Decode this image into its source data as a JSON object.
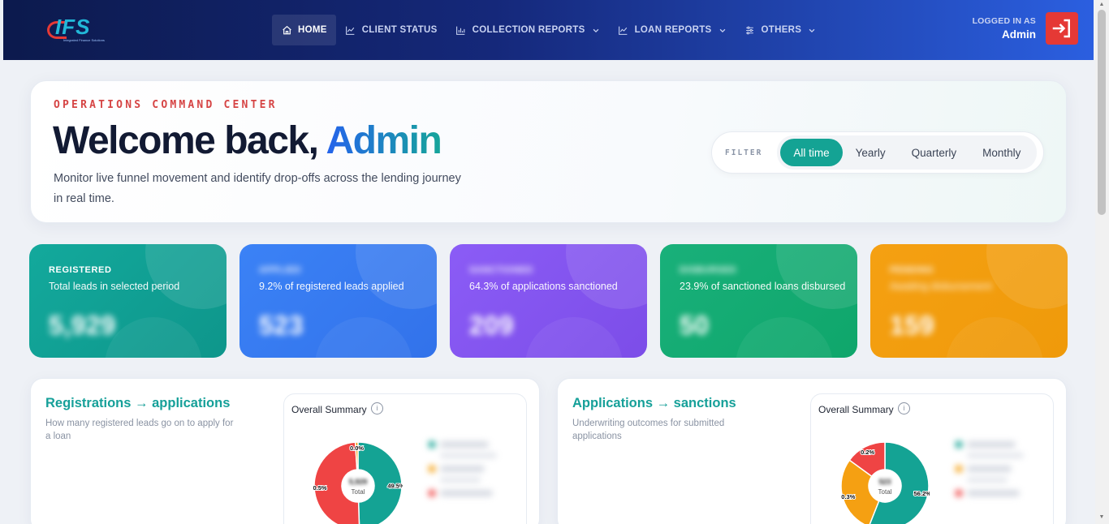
{
  "nav": {
    "logo_text": "IFS",
    "logo_tagline": "Integrated Finance Solutions",
    "items": [
      {
        "label": "HOME",
        "icon": "home-icon",
        "active": true
      },
      {
        "label": "CLIENT STATUS",
        "icon": "line-chart-icon"
      },
      {
        "label": "COLLECTION REPORTS",
        "icon": "bar-chart-icon",
        "dropdown": true
      },
      {
        "label": "LOAN REPORTS",
        "icon": "line-chart-icon",
        "dropdown": true
      },
      {
        "label": "OTHERS",
        "icon": "sliders-icon",
        "dropdown": true
      }
    ],
    "logged_in_label": "LOGGED IN AS",
    "user": "Admin"
  },
  "hero": {
    "eyebrow": "OPERATIONS COMMAND CENTER",
    "welcome_prefix": "Welcome back, ",
    "welcome_name": "Admin",
    "description": "Monitor live funnel movement and identify drop-offs across the lending journey in real time."
  },
  "filter": {
    "label": "FILTER",
    "options": [
      "All time",
      "Yearly",
      "Quarterly",
      "Monthly"
    ],
    "selected": "All time"
  },
  "stats": [
    {
      "title": "REGISTERED",
      "desc": "Total leads in selected period",
      "value": "5,929",
      "color": "#13a99c"
    },
    {
      "title": "APPLIED",
      "desc": "9.2% of registered leads applied",
      "value": "523",
      "color": "#3b82f6"
    },
    {
      "title": "SANCTIONED",
      "desc": "64.3% of applications sanctioned",
      "value": "209",
      "color": "#8b5cf6"
    },
    {
      "title": "DISBURSED",
      "desc": "23.9% of sanctioned loans disbursed",
      "value": "50",
      "color": "#19b07a"
    },
    {
      "title": "PENDING",
      "desc": "Awaiting disbursement",
      "value": "159",
      "color": "#f5a012"
    }
  ],
  "panels": [
    {
      "title": "Registrations → applications",
      "desc": "How many registered leads go on to apply for a loan",
      "summary_title": "Overall Summary",
      "center_value": "5,929",
      "center_label": "Total",
      "slices": [
        {
          "pct": 49.5,
          "color": "#14a394",
          "label": "49.5%"
        },
        {
          "pct": 49.5,
          "color": "#ef4444",
          "label": "0.5%"
        },
        {
          "pct": 1.0,
          "color": "#f5a012",
          "label": "0.0%"
        }
      ]
    },
    {
      "title": "Applications → sanctions",
      "desc": "Underwriting outcomes for submitted applications",
      "summary_title": "Overall Summary",
      "center_value": "523",
      "center_label": "Total",
      "slices": [
        {
          "pct": 56,
          "color": "#14a394",
          "label": "56.2%"
        },
        {
          "pct": 29,
          "color": "#f5a012",
          "label": "0.3%"
        },
        {
          "pct": 15,
          "color": "#ef4444",
          "label": "0.2%"
        }
      ]
    }
  ]
}
